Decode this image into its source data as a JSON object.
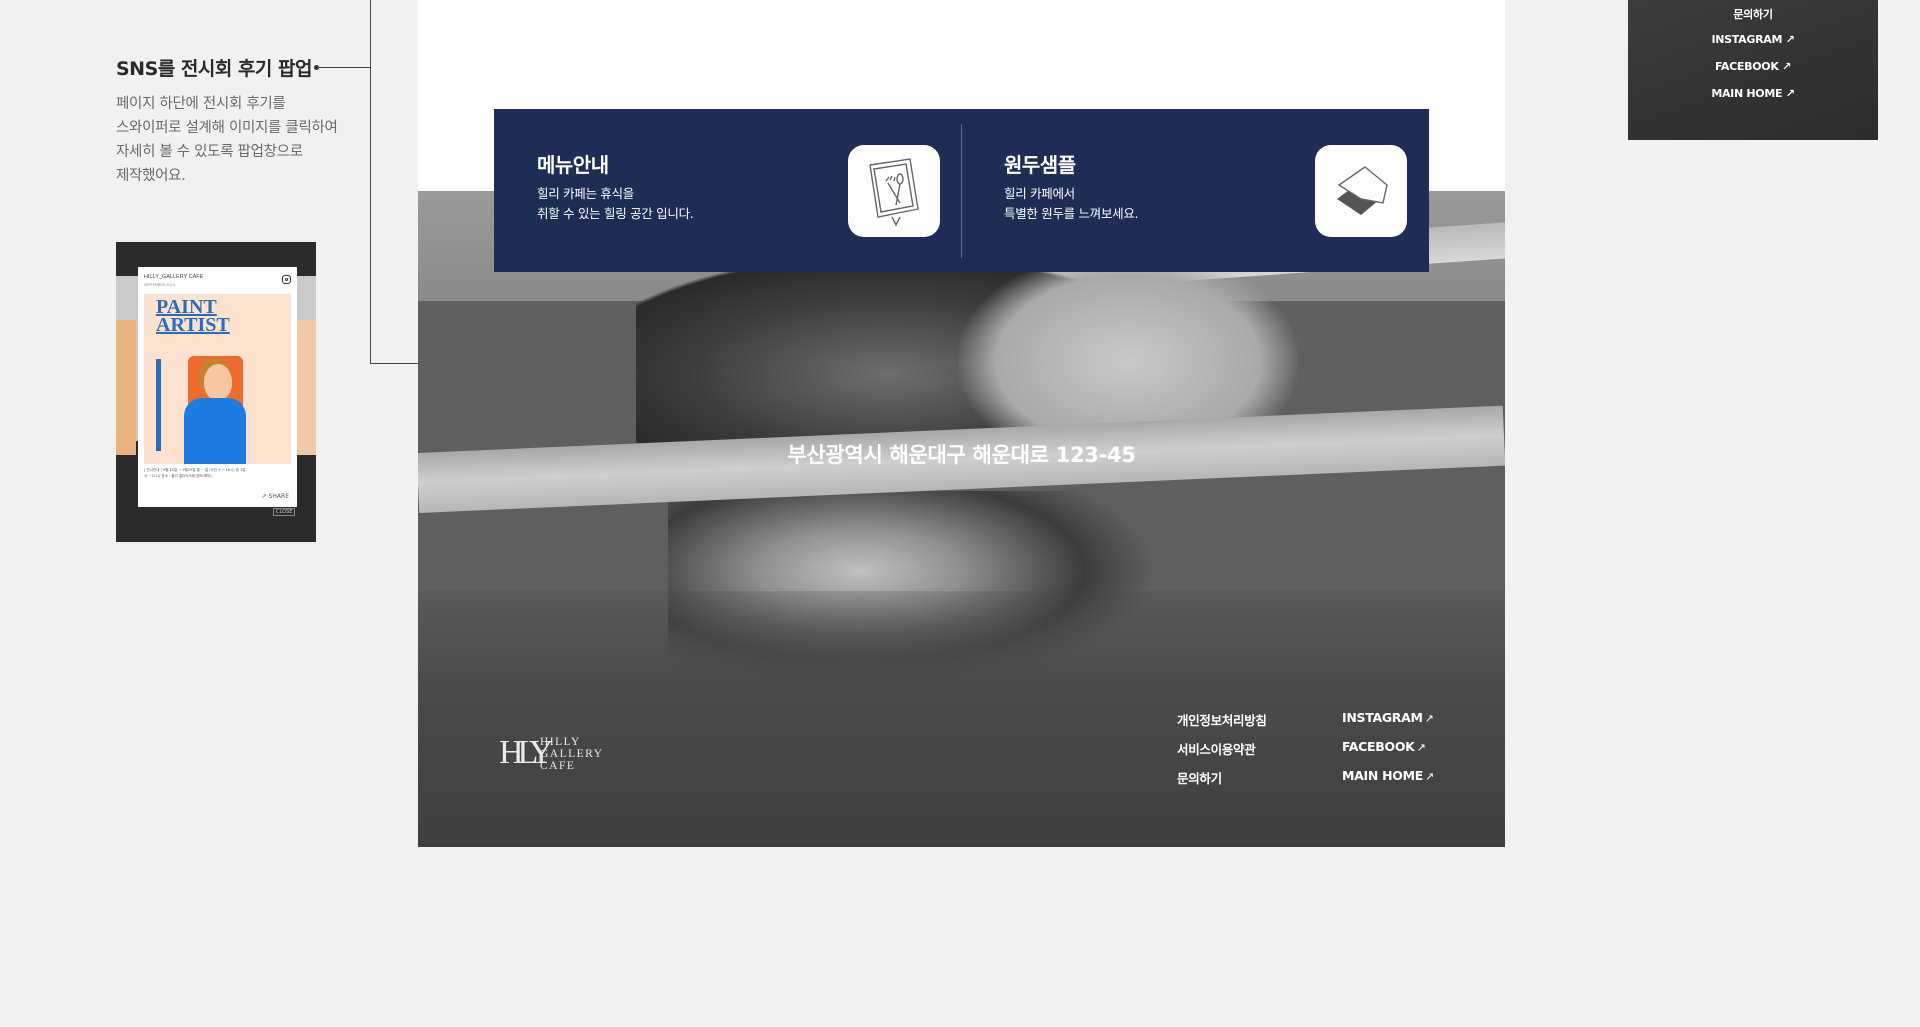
{
  "annotation": {
    "title": "SNS를 전시회 후기 팝업",
    "lines": [
      "페이지 하단에 전시회 후기를",
      "스와이퍼로 설계해 이미지를 클릭하여",
      "자세히 볼 수 있도록 팝업창으로",
      "제작했어요."
    ]
  },
  "thumbnail": {
    "brand": "HILLY_GALLERY CAFE",
    "subtitle": "SEPTEMBER 2024",
    "poster_title": [
      "PAINT",
      "ARTIST"
    ],
    "info": [
      "[ 전시안내 ] 9월 10일 ~ 9월29일 월 ~ 일 (오전 9 ~ 18시) 휴 1일",
      "서 ~12시) 장소 : 힐리 갤러리카페 정보(예약)"
    ],
    "share": "SHARE",
    "close": "CLOSE"
  },
  "banner": {
    "cards": [
      {
        "title": "메뉴안내",
        "desc": [
          "힐리 카페는 휴식을",
          "취할 수 있는 힐링 공간 입니다."
        ],
        "icon": "menu-book-icon"
      },
      {
        "title": "원두샘플",
        "desc": [
          "힐리 카페에서",
          "특별한 원두를 느껴보세요."
        ],
        "icon": "coffee-sample-icon"
      }
    ]
  },
  "hero": {
    "address": "부산광역시 해운대구 해운대로 123-45"
  },
  "footer": {
    "logo": {
      "mono": "HLY",
      "lines": [
        "HILLY",
        "GALLERY",
        "CAFE"
      ]
    },
    "policy_links": [
      "개인정보처리방침",
      "서비스이용약관",
      "문의하기"
    ],
    "external_links": [
      "INSTAGRAM",
      "FACEBOOK",
      "MAIN HOME"
    ],
    "arrow": "↗"
  },
  "mini_preview": {
    "links": [
      "문의하기",
      "INSTAGRAM ↗",
      "FACEBOOK ↗",
      "MAIN HOME ↗"
    ]
  },
  "colors": {
    "banner": "#1e2d56",
    "background": "#f1f1f0",
    "footer": "#4b4b4b"
  }
}
